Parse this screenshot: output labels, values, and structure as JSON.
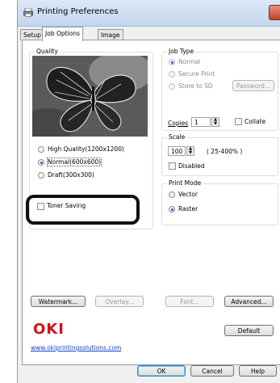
{
  "window": {
    "title": "Printing Preferences"
  },
  "tabs": [
    {
      "label": "Setup",
      "active": false
    },
    {
      "label": "Job Options",
      "active": true
    },
    {
      "label": "Image",
      "active": false
    }
  ],
  "quality": {
    "group_label": "Quality",
    "options": [
      {
        "label": "High Quality(1200x1200)",
        "selected": false
      },
      {
        "label": "Normal(600x600)",
        "selected": true
      },
      {
        "label": "Draft(300x300)",
        "selected": false
      }
    ],
    "toner_saving": {
      "label": "Toner Saving",
      "checked": false
    }
  },
  "job_type": {
    "group_label": "Job Type",
    "options": [
      {
        "label": "Normal",
        "selected": true
      },
      {
        "label": "Secure Print",
        "selected": false
      },
      {
        "label": "Store to SD",
        "selected": false
      }
    ],
    "password_button": "Password...",
    "copies_label": "Copies",
    "copies_value": "1",
    "collate_label": "Collate"
  },
  "scale": {
    "group_label": "Scale",
    "value": "100",
    "range_text": "( 25-400% )",
    "disabled_label": "Disabled"
  },
  "print_mode": {
    "group_label": "Print Mode",
    "options": [
      {
        "label": "Vector",
        "selected": false
      },
      {
        "label": "Raster",
        "selected": true
      }
    ]
  },
  "buttons": {
    "watermark": "Watermark...",
    "overlay": "Overlay...",
    "font": "Font...",
    "advanced": "Advanced...",
    "default": "Default",
    "ok": "OK",
    "cancel": "Cancel",
    "help": "Help"
  },
  "brand": {
    "logo": "OKI",
    "link": "www.okiprintingsolutions.com"
  },
  "colors": {
    "oki_red": "#d0101a",
    "link_blue": "#1a3ec9",
    "radio_selected": "#1c5ec7"
  }
}
